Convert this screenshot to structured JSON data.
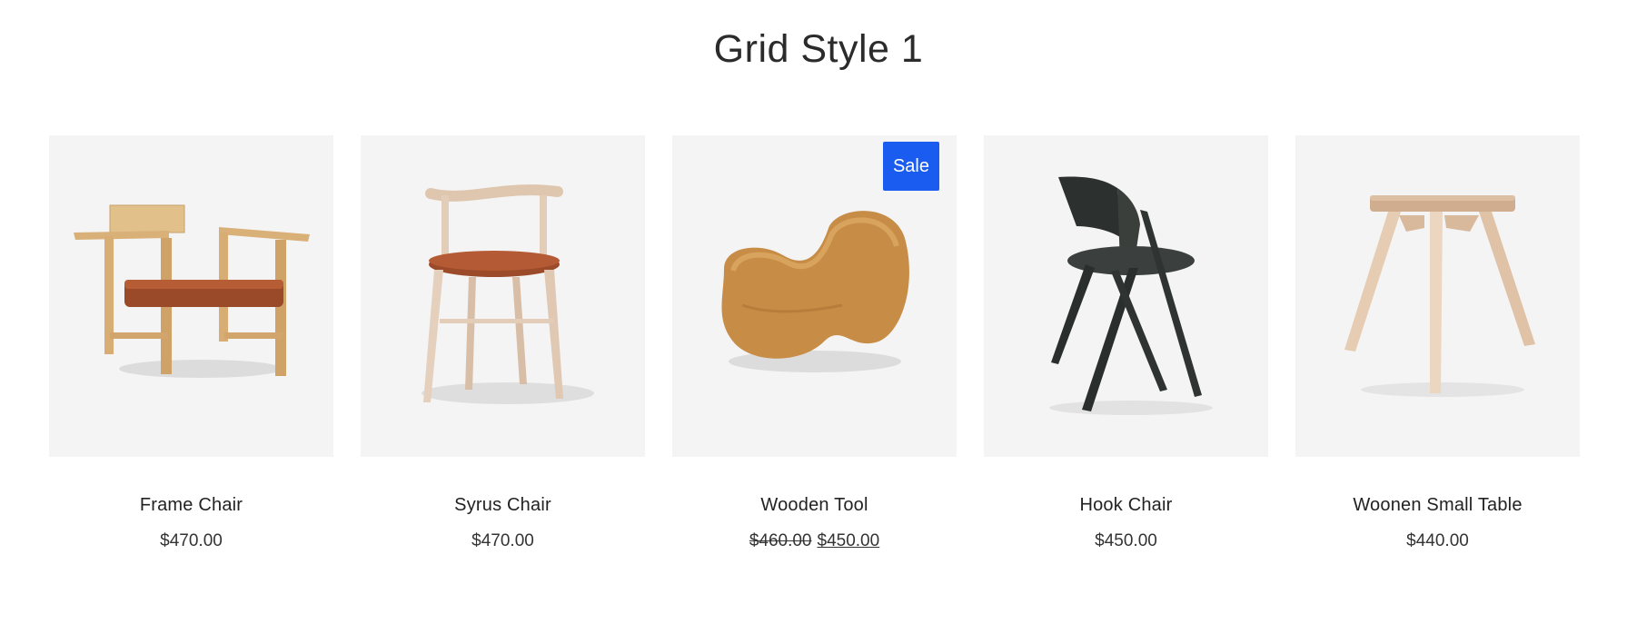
{
  "section": {
    "title": "Grid Style 1"
  },
  "products": [
    {
      "name": "Frame Chair",
      "price": "$470.00",
      "image_icon": "frame-chair-image"
    },
    {
      "name": "Syrus Chair",
      "price": "$470.00",
      "image_icon": "syrus-chair-image"
    },
    {
      "name": "Wooden Tool",
      "old_price": "$460.00",
      "price": "$450.00",
      "badge": "Sale",
      "image_icon": "wooden-tool-image"
    },
    {
      "name": "Hook Chair",
      "price": "$450.00",
      "image_icon": "hook-chair-image"
    },
    {
      "name": "Woonen Small Table",
      "price": "$440.00",
      "image_icon": "small-table-image"
    }
  ],
  "colors": {
    "sale_badge": "#1a5cf0",
    "image_bg": "#f4f4f4",
    "text": "#222222"
  }
}
